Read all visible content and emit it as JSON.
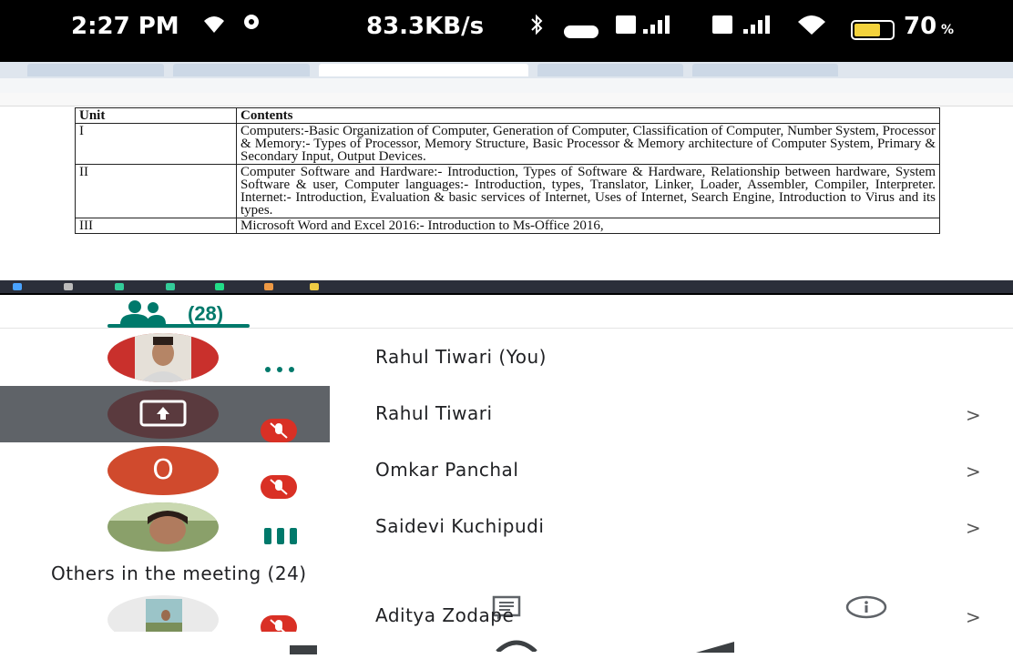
{
  "status_bar": {
    "time": "2:27 PM",
    "network_speed": "83.3KB/s",
    "battery": "70",
    "battery_level_percent": 70,
    "battery_color": "#f3d23c"
  },
  "shared_screen": {
    "table": {
      "headers": [
        "Unit",
        "Contents"
      ],
      "rows": [
        {
          "unit": "I",
          "content": "Computers:-Basic Organization of Computer, Generation of Computer, Classification of Computer, Number System, Processor & Memory:- Types of Processor, Memory Structure, Basic Processor & Memory architecture of Computer System, Primary & Secondary Input, Output Devices."
        },
        {
          "unit": "II",
          "content": "Computer Software and Hardware:- Introduction, Types of Software & Hardware, Relationship between hardware, System Software & user, Computer languages:- Introduction, types, Translator, Linker, Loader, Assembler, Compiler, Interpreter. Internet:- Introduction, Evaluation & basic services of Internet, Uses of Internet, Search Engine, Introduction to Virus and its types."
        },
        {
          "unit": "III",
          "content": "Microsoft Word and Excel 2016:- Introduction to Ms-Office 2016,"
        }
      ]
    }
  },
  "tabs": {
    "people_count": "(28)",
    "accent_color": "#00796b"
  },
  "participants": [
    {
      "name": "Rahul Tiwari (You)",
      "chevron": ""
    },
    {
      "name": "Rahul Tiwari",
      "chevron": ">"
    },
    {
      "name": "Omkar Panchal",
      "chevron": ">"
    },
    {
      "name": "Saidevi Kuchipudi",
      "chevron": ">"
    }
  ],
  "others": {
    "label": "Others in the meeting (24)",
    "participants": [
      {
        "name": "Aditya Zodape",
        "chevron": ">"
      }
    ]
  },
  "avatar_letters": {
    "omkar": "O"
  },
  "colors": {
    "muted": "#d93025",
    "presenting_row": "#5f6368",
    "avatar_o": "#d04a2d"
  }
}
